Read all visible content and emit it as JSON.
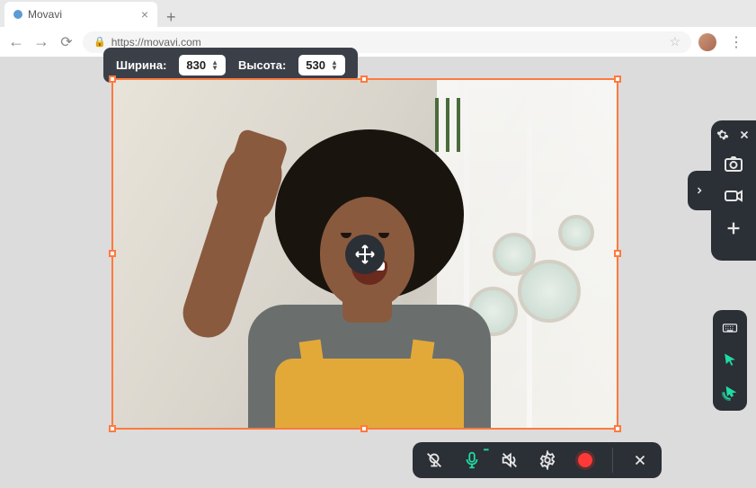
{
  "browser": {
    "tab_title": "Movavi",
    "url": "https://movavi.com"
  },
  "dimensions": {
    "width_label": "Ширина:",
    "width_value": "830",
    "height_label": "Высота:",
    "height_value": "530"
  },
  "side_panel": {
    "icons": [
      "settings",
      "close",
      "camera",
      "video",
      "add"
    ]
  },
  "mini_panel": {
    "icons": [
      "keyboard",
      "cursor",
      "click-ripple"
    ]
  },
  "bottom_bar": {
    "icons": [
      "webcam-off",
      "mic-on",
      "audio-off",
      "settings",
      "record",
      "close"
    ]
  }
}
